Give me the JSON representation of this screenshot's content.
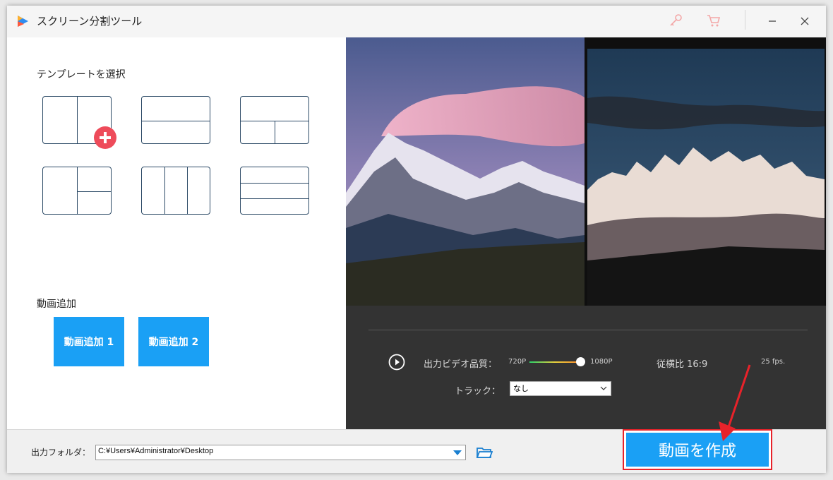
{
  "window": {
    "title": "スクリーン分割ツール"
  },
  "templates": {
    "heading": "テンプレートを選択"
  },
  "add_video": {
    "heading": "動画追加",
    "button1": "動画追加 1",
    "button2": "動画追加 2"
  },
  "controls": {
    "quality_label": "出力ビデオ品質：",
    "quality_min": "720P",
    "quality_max": "1080P",
    "quality_value": 1.0,
    "aspect": "従横比 16:9",
    "fps": "25 fps.",
    "track_label": "トラック：",
    "track_value": "なし"
  },
  "output": {
    "folder_label": "出力フォルダ：",
    "path": "C:¥Users¥Administrator¥Desktop",
    "create_button": "動画を作成"
  },
  "colors": {
    "accent": "#1aa0f5",
    "highlight": "#e8222a",
    "panel_dark": "#333333",
    "template_line": "#2c4a66"
  }
}
